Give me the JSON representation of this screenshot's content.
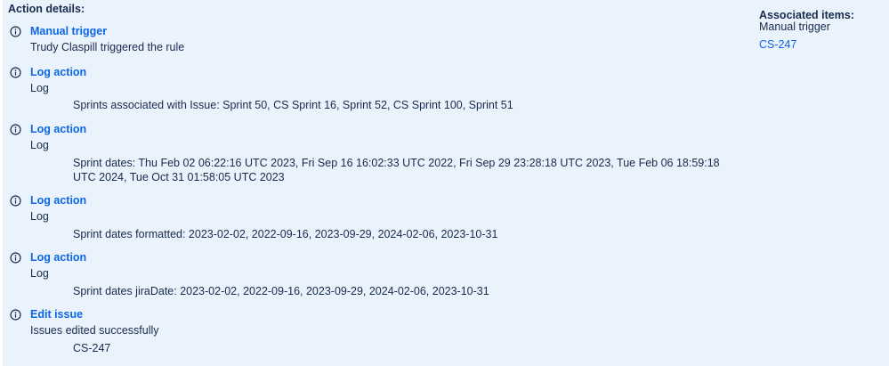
{
  "heading": "Action details:",
  "associated": {
    "title": "Associated items:",
    "trigger_label": "Manual trigger",
    "issue_link": "CS-247"
  },
  "entries": [
    {
      "title": "Manual trigger",
      "sub": "Trudy Claspill triggered the rule",
      "detail": ""
    },
    {
      "title": "Log action",
      "sub": "Log",
      "detail": "Sprints associated with Issue: Sprint 50, CS Sprint 16, Sprint 52, CS Sprint 100, Sprint 51"
    },
    {
      "title": "Log action",
      "sub": "Log",
      "detail": "Sprint dates: Thu Feb 02 06:22:16 UTC 2023, Fri Sep 16 16:02:33 UTC 2022, Fri Sep 29 23:28:18 UTC 2023, Tue Feb 06 18:59:18 UTC 2024, Tue Oct 31 01:58:05 UTC 2023"
    },
    {
      "title": "Log action",
      "sub": "Log",
      "detail": "Sprint dates formatted: 2023-02-02, 2022-09-16, 2023-09-29, 2024-02-06, 2023-10-31"
    },
    {
      "title": "Log action",
      "sub": "Log",
      "detail": "Sprint dates jiraDate: 2023-02-02, 2022-09-16, 2023-09-29, 2024-02-06, 2023-10-31"
    },
    {
      "title": "Edit issue",
      "sub": "Issues edited successfully",
      "detail": "CS-247"
    }
  ],
  "colors": {
    "background": "#eaf2fc",
    "link": "#0c66e4",
    "text": "#172b4d"
  },
  "icons": {
    "entry": "info-icon"
  }
}
